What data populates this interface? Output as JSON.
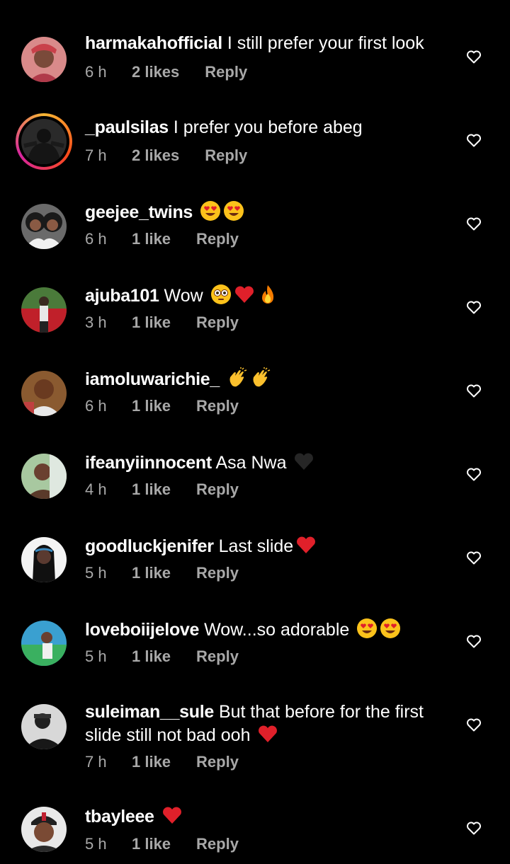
{
  "comments": [
    {
      "username": "harmakahofficial",
      "text": " I still prefer your first look",
      "time": "6 h",
      "likes": "2 likes",
      "reply": "Reply"
    },
    {
      "username": "_paulsilas",
      "text": " I prefer you before abeg",
      "time": "7 h",
      "likes": "2 likes",
      "reply": "Reply"
    },
    {
      "username": "geejee_twins",
      "text": " ",
      "time": "6 h",
      "likes": "1 like",
      "reply": "Reply"
    },
    {
      "username": "ajuba101",
      "text": " Wow ",
      "time": "3 h",
      "likes": "1 like",
      "reply": "Reply"
    },
    {
      "username": "iamoluwarichie_",
      "text": " ",
      "time": "6 h",
      "likes": "1 like",
      "reply": "Reply"
    },
    {
      "username": "ifeanyiinnocent",
      "text": " Asa Nwa ",
      "time": "4 h",
      "likes": "1 like",
      "reply": "Reply"
    },
    {
      "username": "goodluckjenifer",
      "text": " Last slide",
      "time": "5 h",
      "likes": "1 like",
      "reply": "Reply"
    },
    {
      "username": "loveboiijelove",
      "text": " Wow...so adorable ",
      "time": "5 h",
      "likes": "1 like",
      "reply": "Reply"
    },
    {
      "username": "suleiman__sule",
      "text": " But that before for the first slide still not bad ooh ",
      "time": "7 h",
      "likes": "1 like",
      "reply": "Reply"
    },
    {
      "username": "tbayleee",
      "text": " ",
      "time": "5 h",
      "likes": "1 like",
      "reply": "Reply"
    }
  ],
  "emoji_icons": [
    "heart-eyes-emoji",
    "flushed-emoji",
    "red-heart-emoji",
    "fire-emoji",
    "clapping-hands-emoji",
    "black-heart-emoji"
  ],
  "colors": {
    "background": "#000000",
    "text": "#ffffff",
    "meta": "#a8a8a8",
    "red_heart": "#e0202a"
  }
}
